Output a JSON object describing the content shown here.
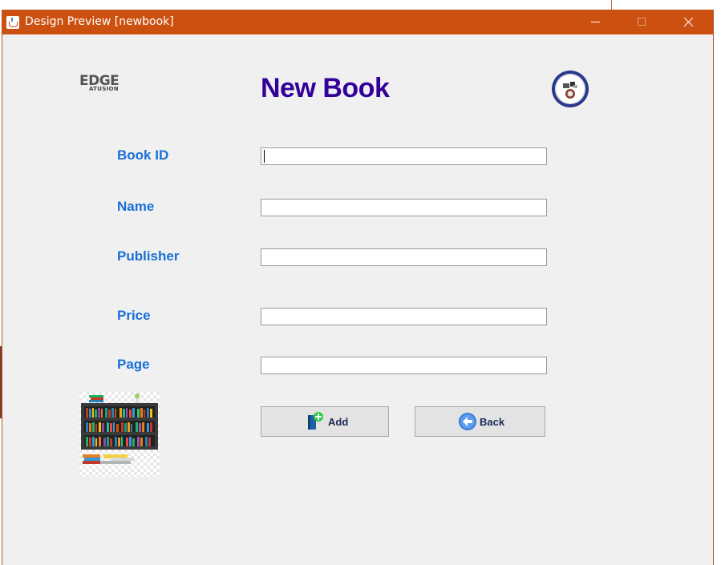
{
  "window": {
    "title": "Design Preview [newbook]",
    "titlebar_color": "#cc5010",
    "controls": [
      "minimize-icon",
      "maximize-icon",
      "close-icon"
    ]
  },
  "header": {
    "logo_left": {
      "text_main": "EDGE",
      "text_sub": "ATUSION"
    },
    "title": "New Book",
    "title_color": "#330099"
  },
  "form": {
    "label_color": "#1a6fd6",
    "fields": [
      {
        "label": "Book ID",
        "value": ""
      },
      {
        "label": "Name",
        "value": ""
      },
      {
        "label": "Publisher",
        "value": ""
      },
      {
        "label": "Price",
        "value": ""
      },
      {
        "label": "Page",
        "value": ""
      }
    ]
  },
  "actions": {
    "add": {
      "label": "Add",
      "icon": "add-book-icon"
    },
    "back": {
      "label": "Back",
      "icon": "back-arrow-icon"
    }
  },
  "images": {
    "illustration": "bookshelf-image",
    "seal": "institution-seal"
  }
}
